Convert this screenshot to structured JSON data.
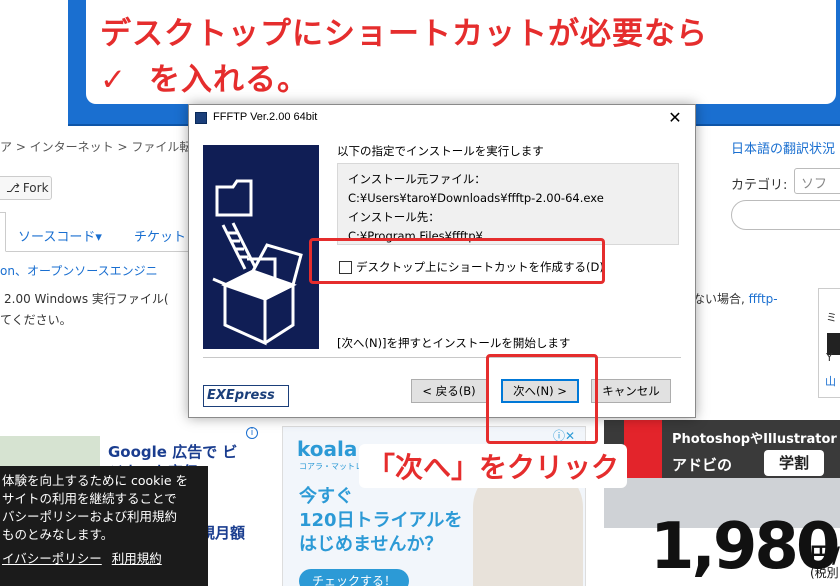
{
  "background_page": {
    "breadcrumb": "ア > インターネット > ファイル転",
    "fork_label": "Fork",
    "tabs": [
      "ソースコード▾",
      "チケット"
    ],
    "tagline": "on、オープンソースエンジニ",
    "desc_line1": "2.00 Windows 実行ファイル(",
    "desc_line2": "てください。",
    "right_link": "日本語の翻訳状況",
    "category_label": "カテゴリ:",
    "category_value": "ソフ",
    "right_text_prefix": "ない場合,",
    "right_text_link": "ffftp-",
    "right_box": [
      "ミ",
      "Y",
      "山"
    ]
  },
  "ads": {
    "google_title": "Google 広告で ビジネスを宣伝",
    "google_sub": "規月額",
    "koala_logo": "koala",
    "koala_small": "コアラ・マットレス",
    "koala_text": [
      "今すぐ",
      "120日トライアルを",
      "はじめませんか？"
    ],
    "koala_button": "チェックする！",
    "adobe_t1": "PhotoshopやIllustrator",
    "adobe_t2": "アドビの",
    "adobe_badge": "学割",
    "adobe_price": "1,980",
    "adobe_yen": "円/",
    "adobe_tax": "(税別"
  },
  "cookie": {
    "lines": [
      "体験を向上するために cookie を",
      "サイトの利用を継続することで",
      "バシーポリシーおよび利用規約",
      "ものとみなします。"
    ],
    "links": [
      "イバシーポリシー",
      "利用規約"
    ]
  },
  "dialog": {
    "title": "FFFTP Ver.2.00 64bit",
    "close_glyph": "✕",
    "instruction": "以下の指定でインストールを実行します",
    "info_lines": [
      "インストール元ファイル：",
      "C:¥Users¥taro¥Downloads¥ffftp-2.00-64.exe",
      "インストール先：",
      "C:¥Program Files¥ffftp¥"
    ],
    "checkbox_label": "デスクトップ上にショートカットを作成する(D)",
    "checkbox_checked": false,
    "hint": "[次へ(N)]を押すとインストールを開始します",
    "logo": "EXEpress",
    "buttons": {
      "back": "< 戻る(B)",
      "next": "次へ(N) >",
      "cancel": "キャンセル"
    }
  },
  "annotations": {
    "top_line1": "デスクトップにショートカットが必要なら",
    "top_check": "✓",
    "top_line2": "を入れる。",
    "bottom": "「次へ」をクリック",
    "color": "#e52d2d"
  }
}
